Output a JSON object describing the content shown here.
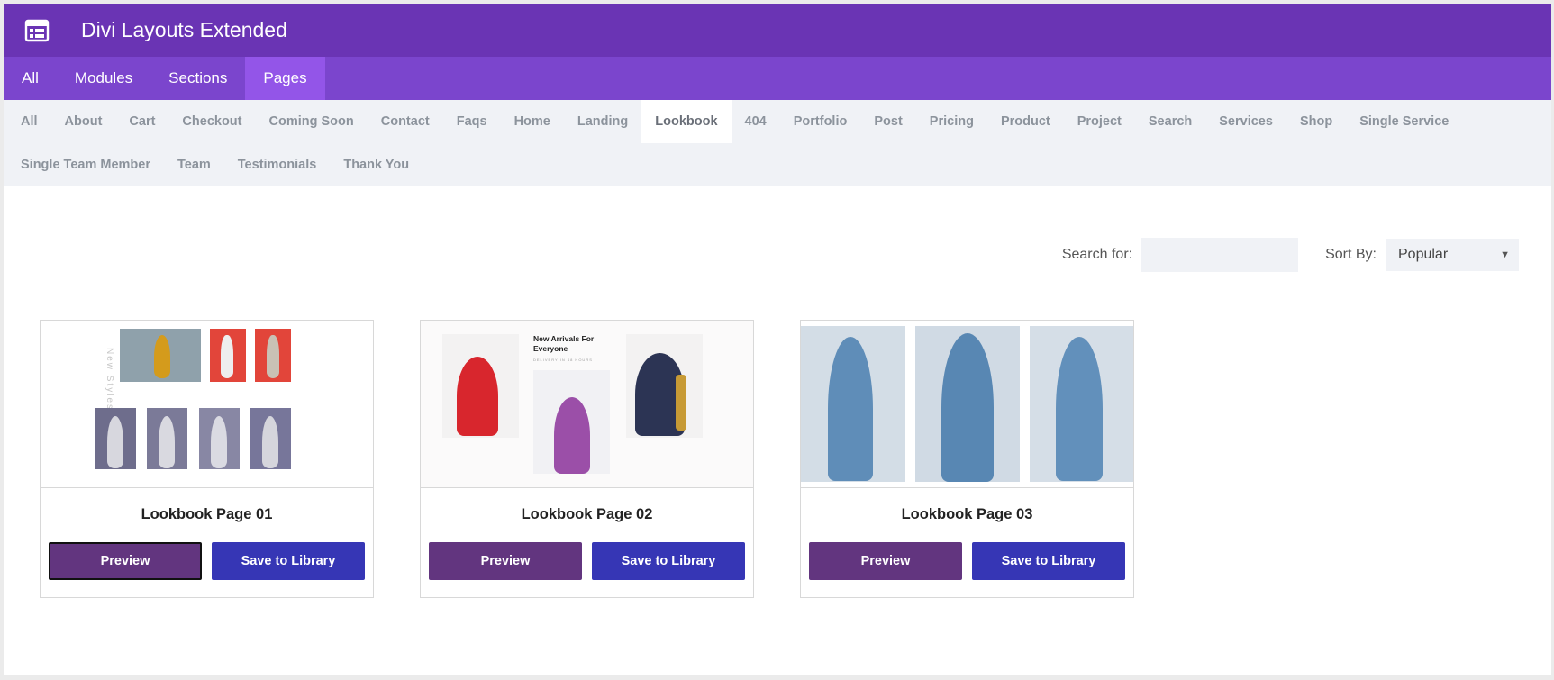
{
  "app": {
    "title": "Divi Layouts Extended",
    "icon": "layout-grid-icon"
  },
  "nav_tabs": [
    {
      "label": "All"
    },
    {
      "label": "Modules"
    },
    {
      "label": "Sections"
    },
    {
      "label": "Pages",
      "active": true
    }
  ],
  "categories": [
    "All",
    "About",
    "Cart",
    "Checkout",
    "Coming Soon",
    "Contact",
    "Faqs",
    "Home",
    "Landing",
    "Lookbook",
    "404",
    "Portfolio",
    "Post",
    "Pricing",
    "Product",
    "Project",
    "Search",
    "Services",
    "Shop",
    "Single Service",
    "Single Team Member",
    "Team",
    "Testimonials",
    "Thank You"
  ],
  "active_category": "Lookbook",
  "search": {
    "label": "Search for:",
    "value": ""
  },
  "sort": {
    "label": "Sort By:",
    "selected": "Popular"
  },
  "cards": [
    {
      "title": "Lookbook Page 01",
      "preview_label": "Preview",
      "save_label": "Save to Library",
      "thumb_text": "New Styles"
    },
    {
      "title": "Lookbook Page 02",
      "preview_label": "Preview",
      "save_label": "Save to Library",
      "thumb_heading": "New Arrivals For Everyone",
      "thumb_sub": "DELIVERY IN 48 HOURS"
    },
    {
      "title": "Lookbook Page 03",
      "preview_label": "Preview",
      "save_label": "Save to Library"
    }
  ],
  "colors": {
    "titlebar": "#6a34b4",
    "navbar": "#7b45cd",
    "nav_active": "#9355e8",
    "preview_button": "#62357f",
    "save_button": "#3636b5"
  }
}
